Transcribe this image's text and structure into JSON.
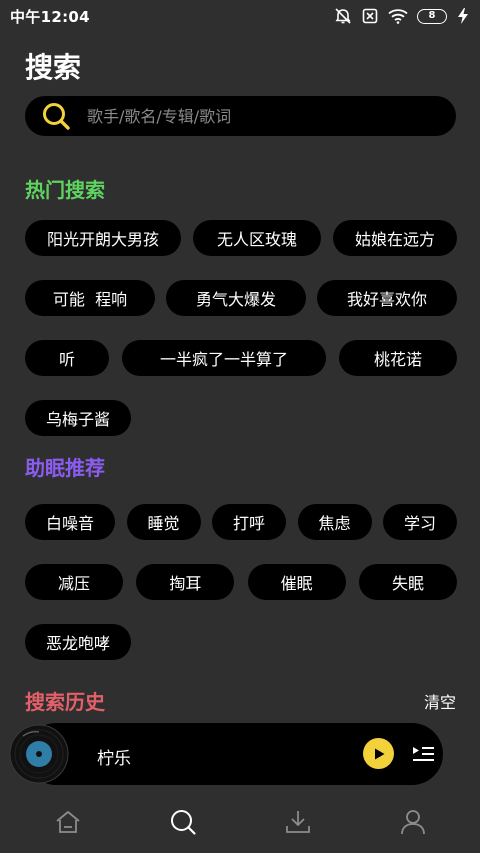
{
  "status_bar": {
    "time": "中午12:04",
    "battery": "8",
    "icons": [
      "alarm-off-icon",
      "sim-off-icon",
      "wifi-icon",
      "battery-icon",
      "charging-icon"
    ]
  },
  "page": {
    "title": "搜索"
  },
  "search": {
    "placeholder": "歌手/歌名/专辑/歌词",
    "value": ""
  },
  "hot_search": {
    "title": "热门搜索",
    "color": "#5fd35f",
    "items": [
      "阳光开朗大男孩",
      "无人区玫瑰",
      "姑娘在远方",
      "可能  程响",
      "勇气大爆发",
      "我好喜欢你",
      "听",
      "一半疯了一半算了",
      "桃花诺",
      "乌梅子酱"
    ]
  },
  "sleep_recommend": {
    "title": "助眠推荐",
    "color": "#8b5cf0",
    "items": [
      "白噪音",
      "睡觉",
      "打呼",
      "焦虑",
      "学习",
      "减压",
      "掏耳",
      "催眠",
      "失眠",
      "恶龙咆哮"
    ]
  },
  "history": {
    "title": "搜索历史",
    "color": "#e3606a",
    "clear_label": "清空"
  },
  "player": {
    "name": "柠乐",
    "accent": "#f3d13b"
  },
  "tabs": [
    {
      "name": "home",
      "icon": "home-icon"
    },
    {
      "name": "search",
      "icon": "search-icon",
      "active": true
    },
    {
      "name": "download",
      "icon": "download-icon"
    },
    {
      "name": "profile",
      "icon": "user-icon"
    }
  ]
}
